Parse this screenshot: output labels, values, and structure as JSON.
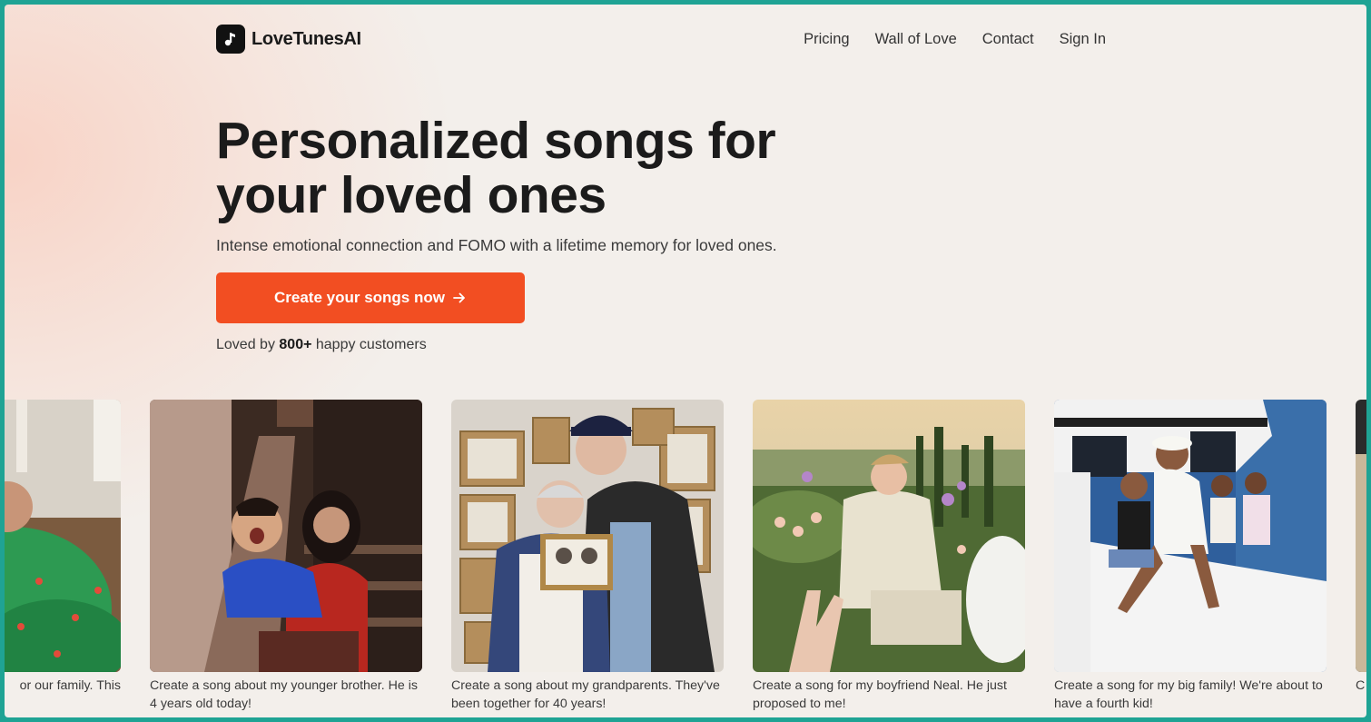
{
  "brand": {
    "name": "LoveTunesAI"
  },
  "nav": {
    "links": [
      "Pricing",
      "Wall of Love",
      "Contact",
      "Sign In"
    ]
  },
  "hero": {
    "title_line1": "Personalized songs for",
    "title_line2": "your loved ones",
    "subtitle": "Intense emotional connection and FOMO with a lifetime memory for loved ones.",
    "cta_label": "Create your songs now",
    "loved_prefix": "Loved by ",
    "loved_count": "800+",
    "loved_suffix": " happy customers"
  },
  "cards": [
    {
      "caption": "or our family. This"
    },
    {
      "caption": "Create a song about my younger brother. He is 4 years old today!"
    },
    {
      "caption": "Create a song about my grandparents. They've been together for 40 years!"
    },
    {
      "caption": "Create a song for my boyfriend Neal. He just proposed to me!"
    },
    {
      "caption": "Create a song for my big family! We're about to have a fourth kid!"
    },
    {
      "caption": "C m"
    }
  ],
  "colors": {
    "accent": "#f24e22",
    "text": "#1b1b1b",
    "background": "#f3efeb"
  }
}
